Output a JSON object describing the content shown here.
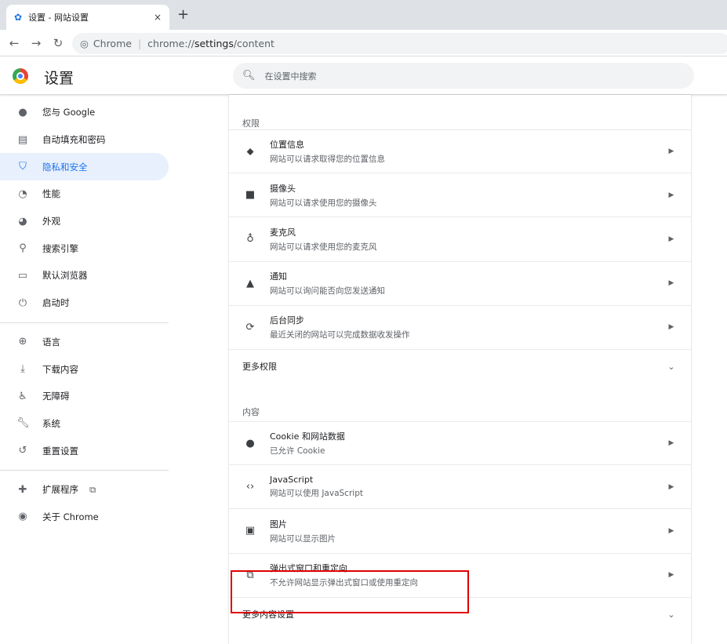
{
  "browser": {
    "tab_title": "设置 - 网站设置",
    "tab_icon": "gear-icon",
    "close_tab": "×",
    "new_tab": "+",
    "chip": "Chrome",
    "url_prefix": "chrome://",
    "url_bold": "settings",
    "url_suffix": "/content"
  },
  "header": {
    "title": "设置",
    "search_placeholder": "在设置中搜索"
  },
  "sidebar": {
    "items": [
      {
        "label": "您与 Google",
        "icon": "person-icon"
      },
      {
        "label": "自动填充和密码",
        "icon": "clipboard-icon"
      },
      {
        "label": "隐私和安全",
        "icon": "shield-icon",
        "active": true
      },
      {
        "label": "性能",
        "icon": "speedometer-icon"
      },
      {
        "label": "外观",
        "icon": "palette-icon"
      },
      {
        "label": "搜索引擎",
        "icon": "search-icon"
      },
      {
        "label": "默认浏览器",
        "icon": "browser-icon"
      },
      {
        "label": "启动时",
        "icon": "power-icon"
      },
      {
        "label": "语言",
        "icon": "globe-icon"
      },
      {
        "label": "下载内容",
        "icon": "download-icon"
      },
      {
        "label": "无障碍",
        "icon": "accessibility-icon"
      },
      {
        "label": "系统",
        "icon": "wrench-icon"
      },
      {
        "label": "重置设置",
        "icon": "reset-icon"
      },
      {
        "label": "扩展程序",
        "icon": "puzzle-icon"
      },
      {
        "label": "关于 Chrome",
        "icon": "chrome-icon"
      }
    ]
  },
  "permissions": {
    "title": "权限",
    "rows": [
      {
        "title": "位置信息",
        "desc": "网站可以请求取得您的位置信息",
        "icon": "location-icon"
      },
      {
        "title": "摄像头",
        "desc": "网站可以请求使用您的摄像头",
        "icon": "camera-icon"
      },
      {
        "title": "麦克风",
        "desc": "网站可以请求使用您的麦克风",
        "icon": "microphone-icon"
      },
      {
        "title": "通知",
        "desc": "网站可以询问能否向您发送通知",
        "icon": "bell-icon"
      },
      {
        "title": "后台同步",
        "desc": "最近关闭的网站可以完成数据收发操作",
        "icon": "sync-icon"
      }
    ],
    "more": "更多权限"
  },
  "content": {
    "title": "内容",
    "rows": [
      {
        "title": "Cookie 和网站数据",
        "desc": "已允许 Cookie",
        "icon": "cookie-icon"
      },
      {
        "title": "JavaScript",
        "desc": "网站可以使用 JavaScript",
        "icon": "code-icon"
      },
      {
        "title": "图片",
        "desc": "网站可以显示图片",
        "icon": "image-icon"
      },
      {
        "title": "弹出式窗口和重定向",
        "desc": "不允许网站显示弹出式窗口或使用重定向",
        "icon": "popup-icon"
      }
    ],
    "more": "更多内容设置"
  },
  "highlight_color": "#e00000"
}
